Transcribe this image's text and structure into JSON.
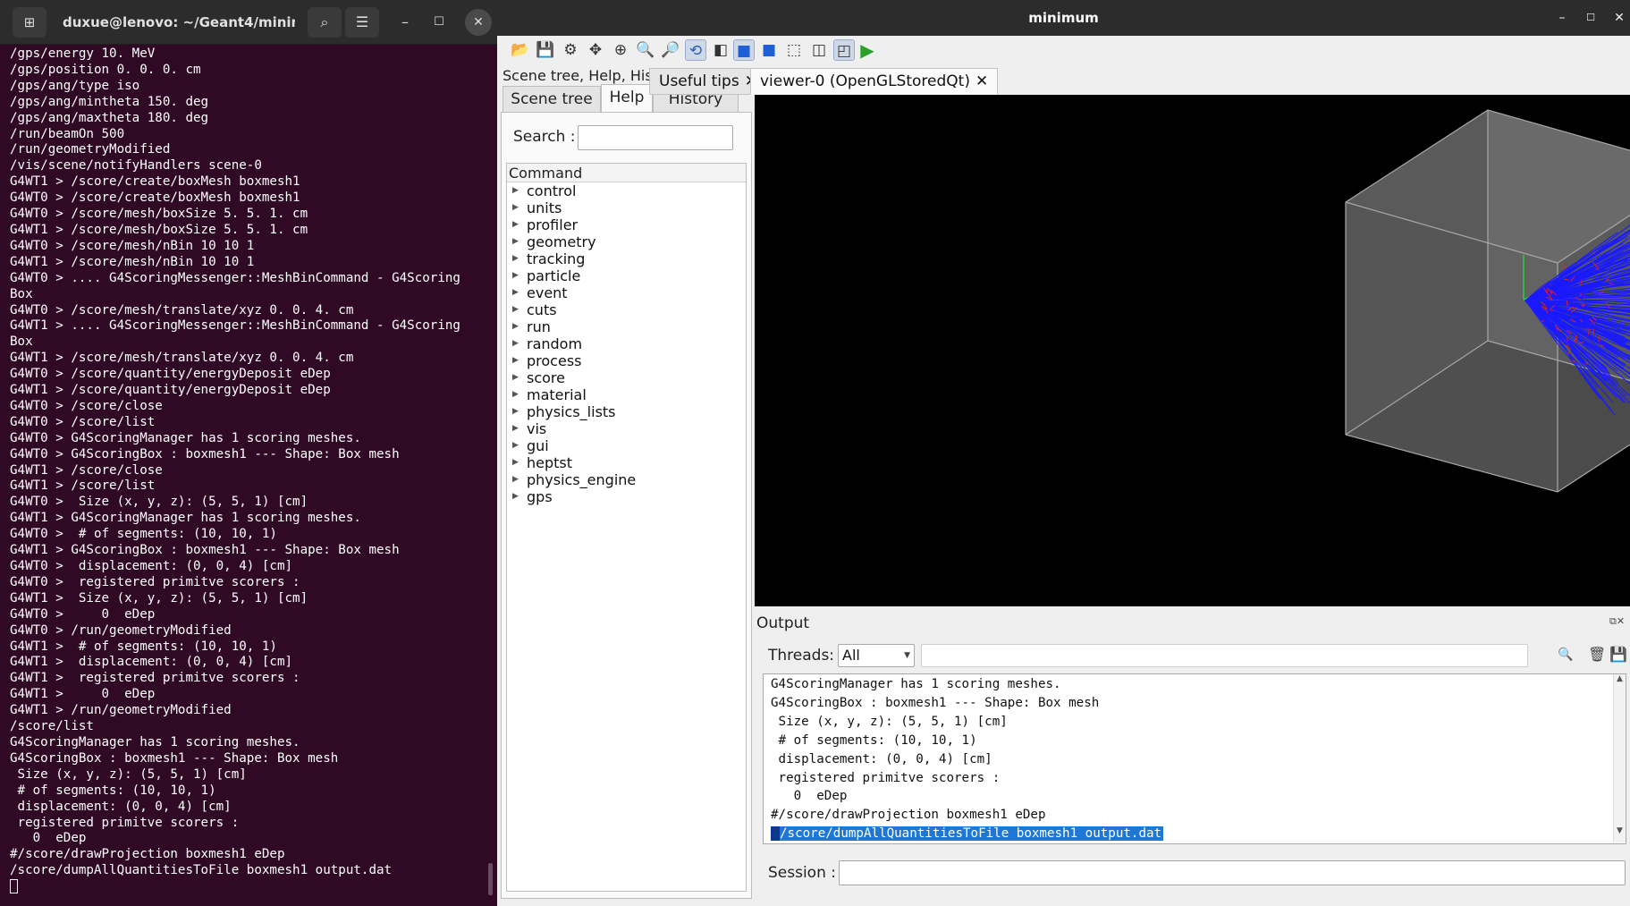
{
  "terminal": {
    "title": "duxue@lenovo: ~/Geant4/minimu...",
    "lines": [
      "/gps/energy 10. MeV",
      "/gps/position 0. 0. 0. cm",
      "/gps/ang/type iso",
      "/gps/ang/mintheta 150. deg",
      "/gps/ang/maxtheta 180. deg",
      "/run/beamOn 500",
      "/run/geometryModified",
      "/vis/scene/notifyHandlers scene-0",
      "G4WT1 > /score/create/boxMesh boxmesh1",
      "G4WT0 > /score/create/boxMesh boxmesh1",
      "G4WT0 > /score/mesh/boxSize 5. 5. 1. cm",
      "G4WT1 > /score/mesh/boxSize 5. 5. 1. cm",
      "G4WT0 > /score/mesh/nBin 10 10 1",
      "G4WT1 > /score/mesh/nBin 10 10 1",
      "G4WT0 > .... G4ScoringMessenger::MeshBinCommand - G4Scoring",
      "Box",
      "G4WT0 > /score/mesh/translate/xyz 0. 0. 4. cm",
      "G4WT1 > .... G4ScoringMessenger::MeshBinCommand - G4Scoring",
      "Box",
      "G4WT1 > /score/mesh/translate/xyz 0. 0. 4. cm",
      "G4WT0 > /score/quantity/energyDeposit eDep",
      "G4WT1 > /score/quantity/energyDeposit eDep",
      "G4WT0 > /score/close",
      "G4WT0 > /score/list",
      "G4WT0 > G4ScoringManager has 1 scoring meshes.",
      "G4WT0 > G4ScoringBox : boxmesh1 --- Shape: Box mesh",
      "G4WT1 > /score/close",
      "G4WT1 > /score/list",
      "G4WT0 >  Size (x, y, z): (5, 5, 1) [cm]",
      "G4WT1 > G4ScoringManager has 1 scoring meshes.",
      "G4WT0 >  # of segments: (10, 10, 1)",
      "G4WT1 > G4ScoringBox : boxmesh1 --- Shape: Box mesh",
      "G4WT0 >  displacement: (0, 0, 4) [cm]",
      "G4WT0 >  registered primitve scorers :",
      "G4WT1 >  Size (x, y, z): (5, 5, 1) [cm]",
      "G4WT0 >     0  eDep",
      "G4WT0 > /run/geometryModified",
      "G4WT1 >  # of segments: (10, 10, 1)",
      "G4WT1 >  displacement: (0, 0, 4) [cm]",
      "G4WT1 >  registered primitve scorers :",
      "G4WT1 >     0  eDep",
      "G4WT1 > /run/geometryModified",
      "/score/list",
      "G4ScoringManager has 1 scoring meshes.",
      "G4ScoringBox : boxmesh1 --- Shape: Box mesh",
      " Size (x, y, z): (5, 5, 1) [cm]",
      " # of segments: (10, 10, 1)",
      " displacement: (0, 0, 4) [cm]",
      " registered primitve scorers :",
      "   0  eDep",
      "#/score/drawProjection boxmesh1 eDep",
      "/score/dumpAllQuantitiesToFile boxmesh1 output.dat"
    ]
  },
  "qt": {
    "title": "minimum",
    "dock_title": "Scene tree, Help, History",
    "tabs": [
      "Scene tree",
      "Help",
      "History"
    ],
    "search_label": "Search :",
    "search_value": "",
    "command_header": "Command",
    "commands": [
      "control",
      "units",
      "profiler",
      "geometry",
      "tracking",
      "particle",
      "event",
      "cuts",
      "run",
      "random",
      "process",
      "score",
      "material",
      "physics_lists",
      "vis",
      "gui",
      "heptst",
      "physics_engine",
      "gps"
    ],
    "viewer_tabs": [
      {
        "label": "Useful tips",
        "selected": false
      },
      {
        "label": "viewer-0 (OpenGLStoredQt)",
        "selected": true
      }
    ],
    "output": {
      "title": "Output",
      "threads_label": "Threads:",
      "threads_value": "All",
      "lines": [
        "G4ScoringManager has 1 scoring meshes.",
        "G4ScoringBox : boxmesh1 --- Shape: Box mesh",
        " Size (x, y, z): (5, 5, 1) [cm]",
        " # of segments: (10, 10, 1)",
        " displacement: (0, 0, 4) [cm]",
        " registered primitve scorers :",
        "   0  eDep",
        "#/score/drawProjection boxmesh1 eDep"
      ],
      "highlighted_line": "/score/dumpAllQuantitiesToFile boxmesh1 output.dat",
      "session_label": "Session :",
      "session_value": ""
    },
    "toolbar_icons": [
      "open-icon",
      "save-icon",
      "settings-icon",
      "move-icon",
      "pick-icon",
      "zoom-out-icon",
      "zoom-in-icon",
      "rotate-icon",
      "hidden-line-icon",
      "solid-icon",
      "surface-icon",
      "wireframe-icon",
      "hlr-icon",
      "perspective-icon",
      "run-icon"
    ]
  },
  "colors": {
    "terminal_bg": "#300a24",
    "viewer_bg": "#000000",
    "tracks": "#1010ff",
    "highlight": "#1e77d2"
  }
}
